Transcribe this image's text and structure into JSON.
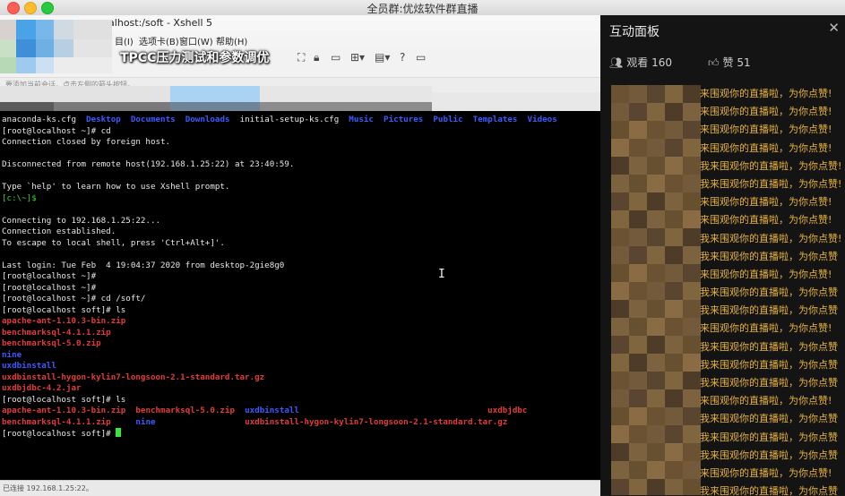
{
  "mac_window": {
    "title": "全员群:优炫软件群直播"
  },
  "xshell": {
    "title": "calhost:/soft - Xshell 5",
    "menu": [
      "目(I)",
      "选项卡(B)",
      "窗口(W)",
      "帮助(H)"
    ],
    "stream_banner": "TPCC压力测试和参数调优",
    "address_text": "要添加当前会话，点击左侧的箭头按钮。",
    "status_text": "已连接 192.168.1.25:22。"
  },
  "terminal": {
    "lines": [
      [
        {
          "t": "anaconda-ks.cfg  "
        },
        {
          "t": "Desktop",
          "c": "blue"
        },
        {
          "t": "  "
        },
        {
          "t": "Documents",
          "c": "blue"
        },
        {
          "t": "  "
        },
        {
          "t": "Downloads",
          "c": "blue"
        },
        {
          "t": "  initial-setup-ks.cfg  "
        },
        {
          "t": "Music",
          "c": "blue"
        },
        {
          "t": "  "
        },
        {
          "t": "Pictures",
          "c": "blue"
        },
        {
          "t": "  "
        },
        {
          "t": "Public",
          "c": "blue"
        },
        {
          "t": "  "
        },
        {
          "t": "Templates",
          "c": "blue"
        },
        {
          "t": "  "
        },
        {
          "t": "Videos",
          "c": "blue"
        }
      ],
      [
        {
          "t": "[root@localhost ~]# cd"
        }
      ],
      [
        {
          "t": "Connection closed by foreign host."
        }
      ],
      [
        {
          "t": ""
        }
      ],
      [
        {
          "t": "Disconnected from remote host(192.168.1.25:22) at 23:40:59."
        }
      ],
      [
        {
          "t": ""
        }
      ],
      [
        {
          "t": "Type `help' to learn how to use Xshell prompt."
        }
      ],
      [
        {
          "t": "[c:\\~]$",
          "c": "green"
        }
      ],
      [
        {
          "t": ""
        }
      ],
      [
        {
          "t": "Connecting to 192.168.1.25:22..."
        }
      ],
      [
        {
          "t": "Connection established."
        }
      ],
      [
        {
          "t": "To escape to local shell, press 'Ctrl+Alt+]'."
        }
      ],
      [
        {
          "t": ""
        }
      ],
      [
        {
          "t": "Last login: Tue Feb  4 19:04:37 2020 from desktop-2gie8g0"
        }
      ],
      [
        {
          "t": "[root@localhost ~]#"
        }
      ],
      [
        {
          "t": "[root@localhost ~]#"
        }
      ],
      [
        {
          "t": "[root@localhost ~]# cd /soft/"
        }
      ],
      [
        {
          "t": "[root@localhost soft]# ls"
        }
      ],
      [
        {
          "t": "apache-ant-1.10.3-bin.zip",
          "c": "red"
        }
      ],
      [
        {
          "t": "benchmarksql-4.1.1.zip",
          "c": "red"
        }
      ],
      [
        {
          "t": "benchmarksql-5.0.zip",
          "c": "red"
        }
      ],
      [
        {
          "t": "nine",
          "c": "blue"
        }
      ],
      [
        {
          "t": "uxdbinstall",
          "c": "blue"
        }
      ],
      [
        {
          "t": "uxdbinstall-hygon-kylin7-longsoon-2.1-standard.tar.gz",
          "c": "red"
        }
      ],
      [
        {
          "t": "uxdbjdbc-4.2.jar",
          "c": "red"
        }
      ],
      [
        {
          "t": "[root@localhost soft]# ls"
        }
      ],
      [
        {
          "t": "apache-ant-1.10.3-bin.zip",
          "c": "red"
        },
        {
          "t": "  "
        },
        {
          "t": "benchmarksql-5.0.zip",
          "c": "red"
        },
        {
          "t": "  "
        },
        {
          "t": "uxdbinstall",
          "c": "blue"
        },
        {
          "t": "                                      "
        },
        {
          "t": "uxdbjdbc",
          "c": "red"
        }
      ],
      [
        {
          "t": "benchmarksql-4.1.1.zip",
          "c": "red"
        },
        {
          "t": "     "
        },
        {
          "t": "nine",
          "c": "blue"
        },
        {
          "t": "                  "
        },
        {
          "t": "uxdbinstall-hygon-kylin7-longsoon-2.1-standard.tar.gz",
          "c": "red"
        }
      ],
      [
        {
          "t": "[root@localhost soft]# "
        },
        {
          "t": "",
          "c": "cursor"
        }
      ]
    ]
  },
  "panel": {
    "title": "互动面板",
    "close_symbol": "✕",
    "viewers_label": "观看",
    "viewers": "160",
    "likes_label": "赞",
    "likes": "51",
    "chat_messages": [
      "来围观你的直播啦，为你点赞!",
      "来围观你的直播啦，为你点赞!",
      "来围观你的直播啦，为你点赞!",
      "来围观你的直播啦，为你点赞!",
      "我来围观你的直播啦，为你点赞!",
      "我来围观你的直播啦，为你点赞!",
      "来围观你的直播啦，为你点赞!",
      "来围观你的直播啦，为你点赞!",
      "我来围观你的直播啦，为你点赞!",
      "我来围观你的直播啦，为你点赞",
      "来围观你的直播啦，为你点赞!",
      "我来围观你的直播啦，为你点赞",
      "我来围观你的直播啦，为你点赞",
      "来围观你的直播啦，为你点赞!",
      "我来围观你的直播啦，为你点赞",
      "我来围观你的直播啦，为你点赞",
      "我来围观你的直播啦，为你点赞",
      "来围观你的直播啦，为你点赞!",
      "我来围观你的直播啦，为你点赞",
      "我来围观你的直播啦，为你点赞",
      "我来围观你的直播啦，为你点赞",
      "来围观你的直播啦，为你点赞!",
      "我来围观你的直播啦，为你点赞"
    ]
  },
  "colors": {
    "terminal_bg": "#000000",
    "terminal_text": "#e8e8e8",
    "file_red": "#e23b3b",
    "dir_blue": "#3b5cff",
    "prompt_green": "#38d238",
    "chat_gold": "#e7b33f",
    "panel_bg": "#141414"
  }
}
